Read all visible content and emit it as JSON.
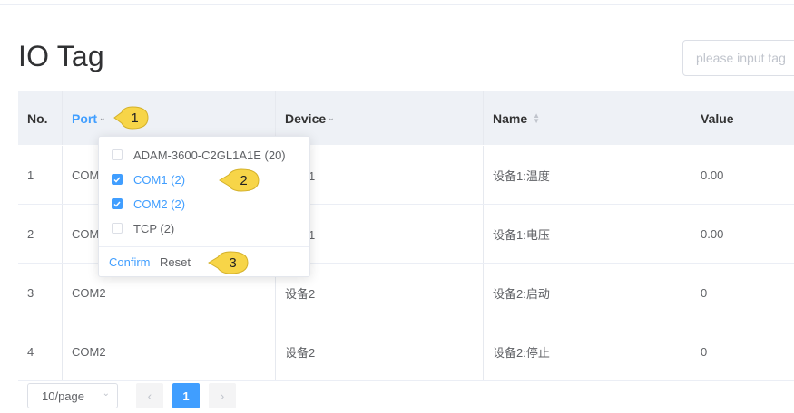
{
  "page": {
    "title": "IO Tag"
  },
  "search": {
    "placeholder": "please input tag"
  },
  "table": {
    "headers": {
      "no": "No.",
      "port": "Port",
      "device": "Device",
      "name": "Name",
      "value": "Value"
    },
    "rows": [
      {
        "no": "1",
        "port": "COM1",
        "device": "设备1",
        "name": "设备1:温度",
        "value": "0.00"
      },
      {
        "no": "2",
        "port": "COM1",
        "device": "设备1",
        "name": "设备1:电压",
        "value": "0.00"
      },
      {
        "no": "3",
        "port": "COM2",
        "device": "设备2",
        "name": "设备2:启动",
        "value": "0"
      },
      {
        "no": "4",
        "port": "COM2",
        "device": "设备2",
        "name": "设备2:停止",
        "value": "0"
      }
    ]
  },
  "filter": {
    "options": [
      {
        "label": "ADAM-3600-C2GL1A1E (20)",
        "checked": false
      },
      {
        "label": "COM1 (2)",
        "checked": true
      },
      {
        "label": "COM2 (2)",
        "checked": true
      },
      {
        "label": "TCP (2)",
        "checked": false
      }
    ],
    "confirm_label": "Confirm",
    "reset_label": "Reset"
  },
  "callouts": [
    "1",
    "2",
    "3"
  ],
  "pagination": {
    "page_size": "10/page",
    "prev": "‹",
    "next": "›",
    "current_page": "1"
  },
  "colors": {
    "accent": "#409eff",
    "header_bg": "#eef1f6",
    "callout": "#f7d548"
  }
}
